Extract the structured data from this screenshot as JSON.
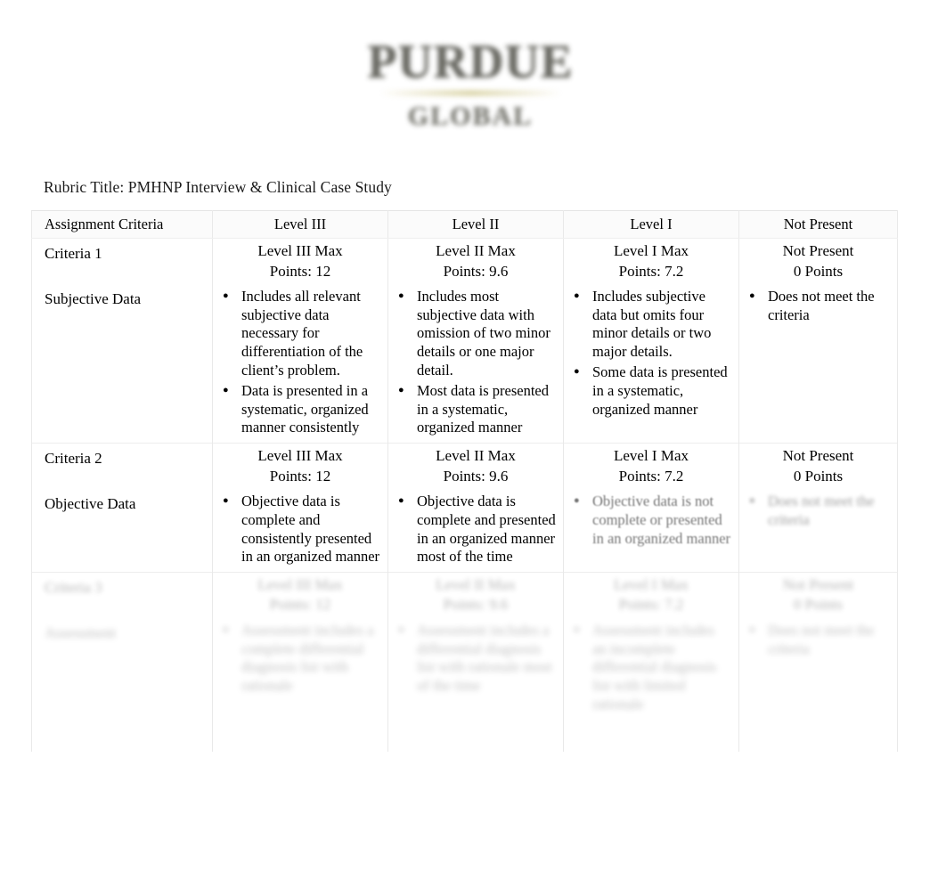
{
  "logo": {
    "main": "Purdue",
    "sub": "Global",
    "accent_color": "#d8d2a3",
    "text_color": "#5c5c55"
  },
  "rubric": {
    "title": "Rubric Title: PMHNP Interview & Clinical Case Study"
  },
  "table": {
    "header": {
      "criteria_col": "Assignment Criteria",
      "level3": "Level III",
      "level2": "Level II",
      "level1": "Level I",
      "not_present": "Not Present"
    },
    "rows": [
      {
        "criteria_number": "Criteria 1",
        "criteria_name": "Subjective Data",
        "level3_max": "Level III Max",
        "level3_points": "Points: 12",
        "level2_max": "Level II Max",
        "level2_points": "Points: 9.6",
        "level1_max": "Level I Max",
        "level1_points": "Points: 7.2",
        "notpresent_max": "Not Present",
        "notpresent_points": "0 Points",
        "level3_bullets": [
          "Includes all relevant subjective data necessary for differentiation of the client’s problem.",
          "Data is presented in a systematic, organized manner consistently"
        ],
        "level2_bullets": [
          "Includes most subjective data with omission of two minor details or one major detail.",
          "Most data is presented in a systematic, organized manner"
        ],
        "level1_bullets": [
          "Includes subjective data but omits four minor details or two major details.",
          "Some data is presented in a systematic, organized manner"
        ],
        "notpresent_bullets": [
          "Does not meet the criteria"
        ]
      },
      {
        "criteria_number": "Criteria 2",
        "criteria_name": "Objective Data",
        "level3_max": "Level III Max",
        "level3_points": "Points: 12",
        "level2_max": "Level II Max",
        "level2_points": "Points: 9.6",
        "level1_max": "Level I Max",
        "level1_points": "Points: 7.2",
        "notpresent_max": "Not Present",
        "notpresent_points": "0 Points",
        "level3_bullets": [
          "Objective data is complete and consistently presented in an organized manner"
        ],
        "level2_bullets": [
          "Objective data is complete and presented in an organized manner most of the time"
        ],
        "level1_bullets": [
          "Objective data is not complete   or presented in an organized manner"
        ],
        "notpresent_bullets": [
          "Does not meet the criteria"
        ]
      },
      {
        "criteria_number": "Criteria 3",
        "criteria_name": "Assessment",
        "level3_max": "Level III Max",
        "level3_points": "Points: 12",
        "level2_max": "Level II Max",
        "level2_points": "Points: 9.6",
        "level1_max": "Level I Max",
        "level1_points": "Points: 7.2",
        "notpresent_max": "Not Present",
        "notpresent_points": "0 Points",
        "level3_bullets": [
          "Assessment includes a complete differential diagnosis list with rationale"
        ],
        "level2_bullets": [
          "Assessment includes a differential diagnosis list with rationale most of the time"
        ],
        "level1_bullets": [
          "Assessment includes an incomplete differential diagnosis list with limited rationale"
        ],
        "notpresent_bullets": [
          "Does not meet the criteria"
        ]
      }
    ]
  }
}
